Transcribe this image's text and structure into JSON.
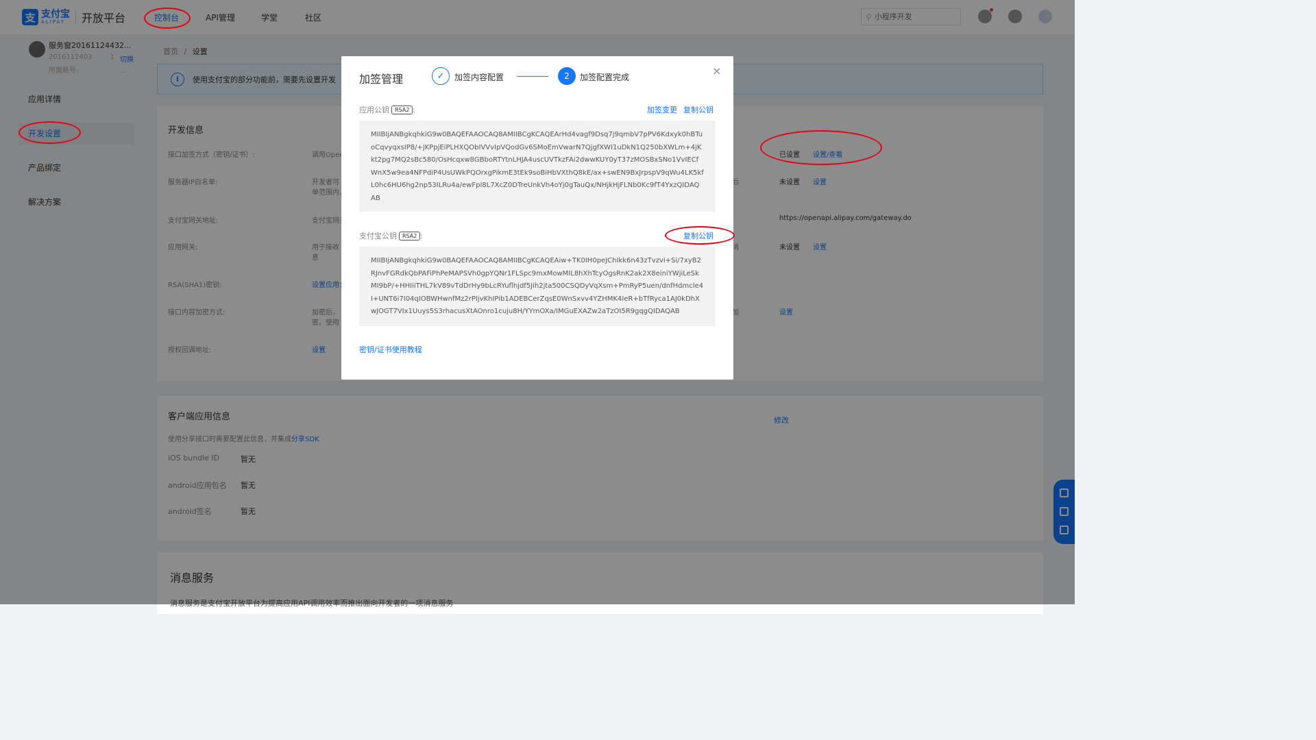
{
  "nav": {
    "logo_cn": "支付宝",
    "logo_en": "ALIPAY",
    "platform": "开放平台",
    "items": [
      "控制台",
      "API管理",
      "学堂",
      "社区"
    ],
    "search_placeholder": "小程序开发"
  },
  "user": {
    "name": "服务窗20161124432...",
    "id": "2016112403",
    "id_suffix": "1",
    "switch": "切换",
    "account": "所属账号:",
    "account_suffix": "..."
  },
  "sidebar": {
    "items": [
      "应用详情",
      "开发设置",
      "产品绑定",
      "解决方案"
    ],
    "active_index": 1
  },
  "breadcrumb": {
    "home": "首页",
    "sep": "/",
    "current": "设置"
  },
  "notice": {
    "text": "使用支付宝的部分功能前，需要先设置开发"
  },
  "dev": {
    "title": "开发信息",
    "rows": [
      {
        "label": "接口加签方式（密钥/证书）:",
        "desc": "调用Open",
        "status": "已设置",
        "link": "设置/查看"
      },
      {
        "label": "服务器IP白名单:",
        "desc": "开发者可",
        "desc2": "单范围内，",
        "frag": "后",
        "status": "未设置",
        "link": "设置"
      },
      {
        "label": "支付宝网关地址:",
        "desc": "支付宝网关",
        "url": "https://openapi.alipay.com/gateway.do"
      },
      {
        "label": "应用网关:",
        "desc": "用于接收",
        "desc2": "息",
        "frag": "消",
        "status": "未设置",
        "link": "设置"
      },
      {
        "label": "RSA(SHA1)密钥:",
        "desc": "设置应用公"
      },
      {
        "label": "接口内容加密方式:",
        "desc": "加密后，",
        "desc2": "密。使用",
        "frag": "加",
        "link": "设置"
      },
      {
        "label": "授权回调地址:",
        "link": "设置"
      }
    ]
  },
  "client": {
    "title": "客户端应用信息",
    "desc": "使用分享接口时需要配置此信息，并集成",
    "sdk_link": "分享SDK",
    "edit": "修改",
    "rows": [
      {
        "label": "iOS bundle ID",
        "value": "暂无"
      },
      {
        "label": "android应用包名",
        "value": "暂无"
      },
      {
        "label": "android签名",
        "value": "暂无"
      }
    ]
  },
  "msg": {
    "title": "消息服务",
    "desc": "消息服务是支付宝开放平台为提高应用API调用效率而推出面向开发者的一项消息服务"
  },
  "modal": {
    "title": "加签管理",
    "close": "×",
    "step1": {
      "icon": "✓",
      "label": "加签内容配置"
    },
    "step2": {
      "num": "2",
      "label": "加签配置完成"
    },
    "app_key": {
      "label": "应用公钥",
      "tag": "RSA2",
      "colon": ":",
      "change": "加签变更",
      "copy": "复制公钥",
      "value": "MIIBIjANBgkqhkiG9w0BAQEFAAOCAQ8AMIIBCgKCAQEArHd4vagf9Dsq7j9qmbV7pPV6Kdxyk0hBTuoCqvyqxsIP8/+jKPpjEiPLHXQObIVVvIpVQodGv6SMoEmVwarN7QjgfXWI1uDkN1Q250bXWLm+4jKkt2pg7MQ2sBc580/OsHcqxw8GBboRTYtnLHJA4uscUVTkzFAi2dwwKUY0yT37zMOSBxSNo1VvIECfWnX5w9ea4NFPdiP4UsUWkPQOrxgPikmE3tEk9soBiHbVXthQ8kE/ax+swEN9BxJrpspV9qWu4LK5kfL0hc6HU6hg2np53ILRu4a/ewFpI8L7XcZ0DTreUnkVh4oYj0gTauQx/NHjkHjFLNb0Kc9fT4YxzQIDAQAB"
    },
    "alipay_key": {
      "label": "支付宝公钥",
      "tag": "RSA2",
      "colon": ":",
      "copy": "复制公钥",
      "value": "MIIBIjANBgkqhkiG9w0BAQEFAAOCAQ8AMIIBCgKCAQEAiw+TK0IH0peJChIkk6n43zTvzvi+Si/7xyB2RJnvFGRdkQbPAFiPhPeMAPSVh0gpYQNr1FLSpc9mxMowMIL8hXhTcyOgsRnK2ak2X8einiYWjiLeSkMI9bP/+HHIiiTHL7kV89vTdDrHy9bLcRYuflhjdf5Jih2jta500CSQDyVqXsm+PmRyP5uen/dnfHdmcle4I+UNT6i7I04qIOBWHwnfMz2rPIjvKhIPib1ADEBCerZqsE0WnSxvv4YZHMK4IeR+bTfRyca1AJ0kDhXwJOGT7VIx1Uuys5S3rhacusXtAOnro1cuju8H/YYmOXa/IMGuEXAZw2aTzOI5R9gqgQIDAQAB"
    },
    "tutorial": "密钥/证书使用教程"
  }
}
